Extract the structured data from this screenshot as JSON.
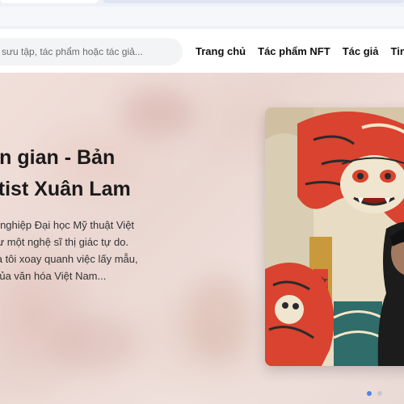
{
  "header": {
    "search": {
      "placeholder": "sưu tập, tác phẩm hoặc tác giả...",
      "value": ""
    },
    "nav": [
      {
        "label": "Trang chủ"
      },
      {
        "label": "Tác phẩm NFT"
      },
      {
        "label": "Tác giả"
      },
      {
        "label": "Tin"
      }
    ]
  },
  "hero": {
    "title_lines": [
      "dân gian - Bản",
      "Artist Xuân Lam"
    ],
    "description_lines": [
      "tốt nghiệp Đại học Mỹ thuật Việt",
      "như một nghệ sĩ thị giác tự do.",
      "của tôi xoay quanh việc lấy mẫu,",
      "ũ của văn hóa Việt Nam..."
    ],
    "artwork": {
      "icon": "tiger-folk-painting-image"
    },
    "carousel": {
      "dots": 2,
      "active_index": 0
    }
  },
  "colors": {
    "accent": "#4a86e8",
    "artwork_red": "#d9432f",
    "artwork_bg": "#e9dcc4"
  }
}
